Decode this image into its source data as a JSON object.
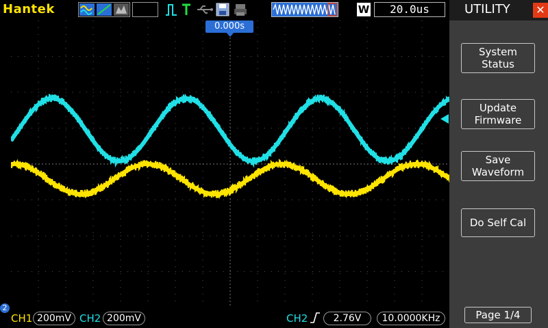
{
  "topbar": {
    "brand": "Hantek",
    "timebase": "20.0us",
    "mode_letter": "W",
    "trigger_offset": "0.000s"
  },
  "panel": {
    "title": "UTILITY",
    "close_icon": "close-icon",
    "buttons": [
      {
        "line1": "System",
        "line2": "Status"
      },
      {
        "line1": "Update",
        "line2": "Firmware"
      },
      {
        "line1": "Save",
        "line2": "Waveform"
      },
      {
        "line1": "Do Self Cal",
        "line2": ""
      }
    ],
    "page": "Page 1/4"
  },
  "bottom": {
    "ch1_label": "CH1",
    "ch1_scale": "200mV",
    "ch2_label": "CH2",
    "ch2_scale": "200mV",
    "trig_source": "CH2",
    "trig_level": "2.76V",
    "frequency": "10.0000KHz",
    "channel_badge": "2"
  },
  "colors": {
    "ch1": "#ffe400",
    "ch2": "#20e0e6",
    "accent": "#2b6fd6",
    "close": "#e23a16"
  },
  "icons": [
    "waveform-display-icon",
    "run-status-icon",
    "trigger-type-icon",
    "usb-icon",
    "save-icon",
    "print-icon"
  ]
}
